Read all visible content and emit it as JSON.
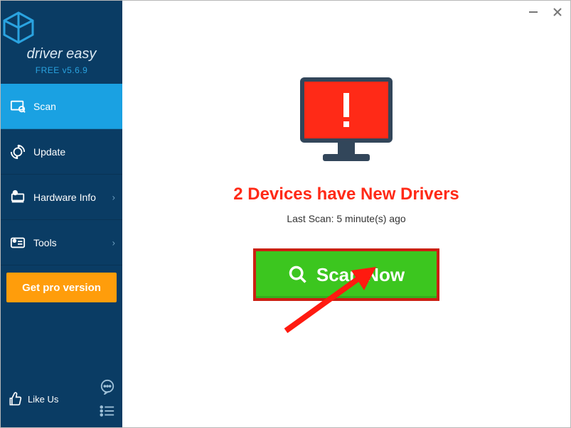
{
  "brand": {
    "name": "driver easy",
    "version": "FREE v5.6.9"
  },
  "nav": {
    "scan": "Scan",
    "update": "Update",
    "hardware": "Hardware Info",
    "tools": "Tools"
  },
  "pro_button": "Get pro version",
  "footer": {
    "likeus": "Like Us"
  },
  "main": {
    "headline": "2 Devices have New Drivers",
    "lastscan": "Last Scan: 5 minute(s) ago",
    "scan_button": "Scan Now"
  }
}
